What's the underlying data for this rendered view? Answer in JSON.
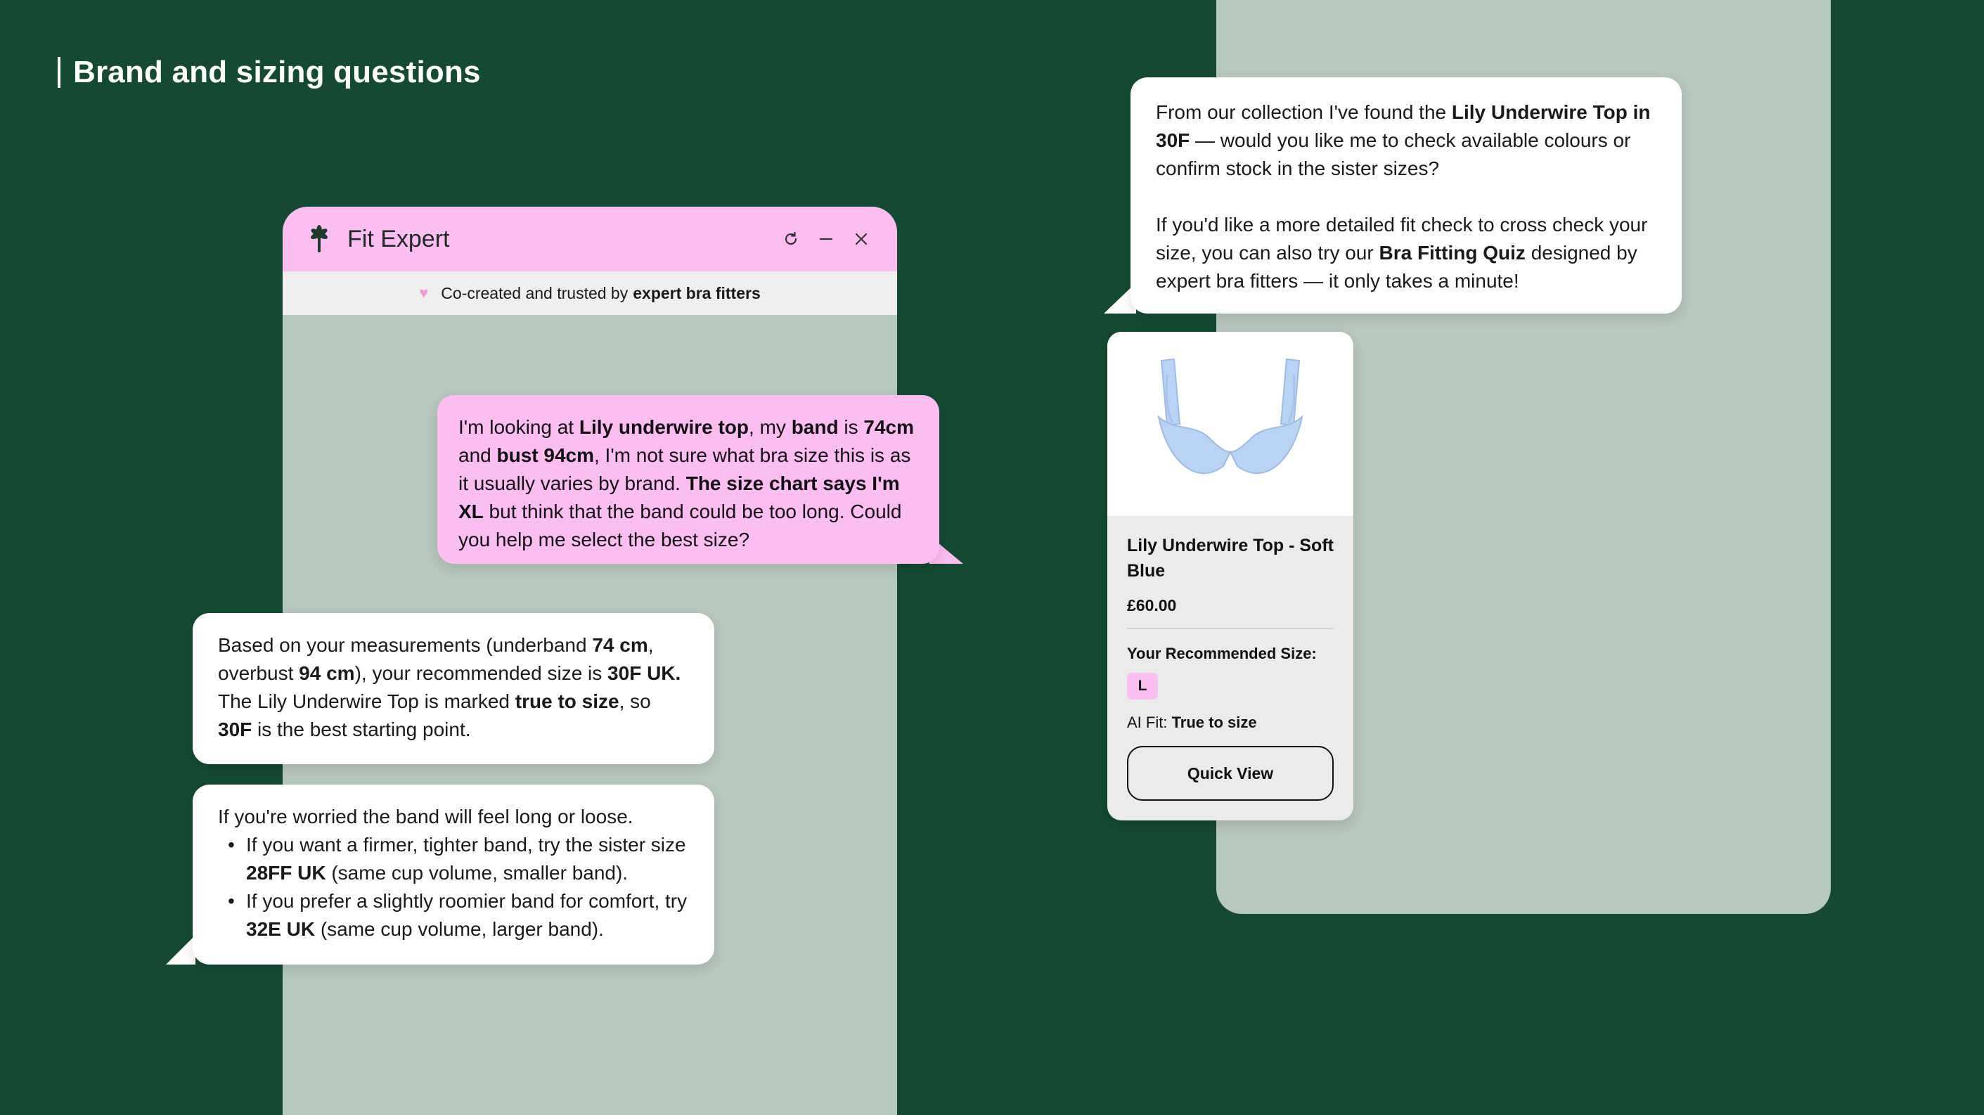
{
  "page": {
    "title": "Brand and sizing questions"
  },
  "widget": {
    "title": "Fit Expert",
    "banner_prefix": "Co-created and trusted by",
    "banner_bold": "expert bra fitters"
  },
  "messages": {
    "user": [
      {
        "t": "I'm looking at ",
        "b": false
      },
      {
        "t": "Lily underwire top",
        "b": true
      },
      {
        "t": ", my ",
        "b": false
      },
      {
        "t": "band",
        "b": true
      },
      {
        "t": " is ",
        "b": false
      },
      {
        "t": "74cm",
        "b": true
      },
      {
        "t": " and ",
        "b": false
      },
      {
        "t": "bust 94cm",
        "b": true
      },
      {
        "t": ", I'm not sure what bra size this is as it usually varies by brand. ",
        "b": false
      },
      {
        "t": "The size chart says I'm XL",
        "b": true
      },
      {
        "t": " but think that the band could be too long. Could you help me select the best size?",
        "b": false
      }
    ],
    "bot_1": [
      {
        "t": "Based on your measurements (underband ",
        "b": false
      },
      {
        "t": "74 cm",
        "b": true
      },
      {
        "t": ", overbust ",
        "b": false
      },
      {
        "t": "94 cm",
        "b": true
      },
      {
        "t": "), your recommended size is ",
        "b": false
      },
      {
        "t": "30F UK.",
        "b": true
      },
      {
        "t": " The Lily Underwire Top is marked ",
        "b": false
      },
      {
        "t": "true to size",
        "b": true
      },
      {
        "t": ", so ",
        "b": false
      },
      {
        "t": "30F",
        "b": true
      },
      {
        "t": " is the best starting point.",
        "b": false
      }
    ],
    "bot_2_intro": "If you're worried the band will feel long or loose.",
    "bot_2_items": [
      [
        {
          "t": "If you want a firmer, tighter band, try the sister size ",
          "b": false
        },
        {
          "t": "28FF UK",
          "b": true
        },
        {
          "t": " (same cup volume, smaller band).",
          "b": false
        }
      ],
      [
        {
          "t": "If you prefer a slightly roomier band for comfort, try ",
          "b": false
        },
        {
          "t": "32E UK",
          "b": true
        },
        {
          "t": " (same cup volume, larger band).",
          "b": false
        }
      ]
    ],
    "bot_3_p1": [
      {
        "t": "From our collection I've found the ",
        "b": false
      },
      {
        "t": "Lily Underwire Top in 30F",
        "b": true
      },
      {
        "t": " — would you like me to check available colours or confirm stock in the sister sizes?",
        "b": false
      }
    ],
    "bot_3_p2": [
      {
        "t": "If you'd like a more detailed fit check to cross check your size, you can also try our ",
        "b": false
      },
      {
        "t": "Bra Fitting Quiz",
        "b": true
      },
      {
        "t": " designed by expert bra fitters — it only takes a minute!",
        "b": false
      }
    ]
  },
  "product": {
    "name": "Lily Underwire Top - Soft Blue",
    "price": "£60.00",
    "rec_label": "Your Recommended Size:",
    "rec_size": "L",
    "ai_fit_label": "AI Fit:",
    "ai_fit_value": "True to size",
    "quick_view_label": "Quick View",
    "image_color": "#b9d3f4"
  },
  "colors": {
    "background": "#134a31",
    "panel": "#b7c8bf",
    "accent_pink": "#fcbdf0"
  }
}
